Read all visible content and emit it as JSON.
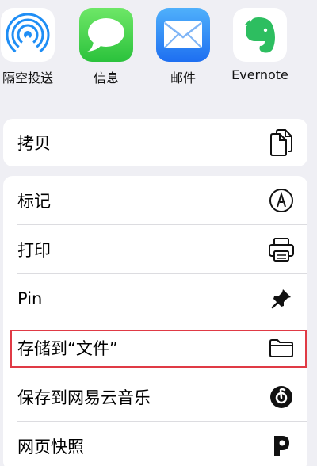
{
  "apps": [
    {
      "label": "隔空投送",
      "icon": "airdrop-icon"
    },
    {
      "label": "信息",
      "icon": "messages-icon"
    },
    {
      "label": "邮件",
      "icon": "mail-icon"
    },
    {
      "label": "Evernote",
      "icon": "evernote-icon"
    }
  ],
  "actions_group1": [
    {
      "label": "拷贝",
      "icon": "copy-icon"
    }
  ],
  "actions_group2": [
    {
      "label": "标记",
      "icon": "markup-icon"
    },
    {
      "label": "打印",
      "icon": "printer-icon"
    },
    {
      "label": "Pin",
      "icon": "pin-icon"
    },
    {
      "label": "存储到“文件”",
      "icon": "folder-icon"
    },
    {
      "label": "保存到网易云音乐",
      "icon": "netease-music-icon"
    },
    {
      "label": "网页快照",
      "icon": "snapshot-icon"
    }
  ],
  "colors": {
    "background": "#efeff4",
    "highlight": "#e03a45",
    "messages": "#2bc23c",
    "mail": "#1e6ff1",
    "evernote": "#2dbe60",
    "airdrop": "#1f8ef5"
  }
}
